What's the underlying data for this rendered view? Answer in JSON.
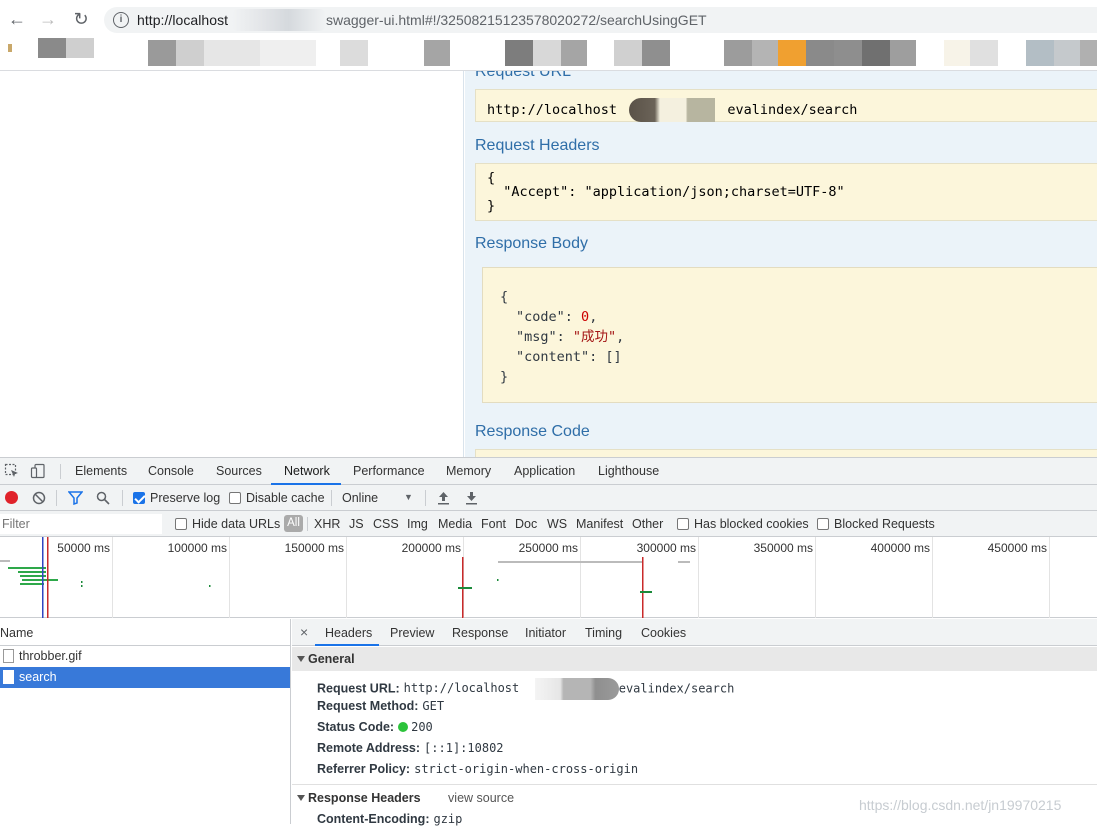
{
  "browser": {
    "url_start": "http://localhost",
    "url_end": "swagger-ui.html#!/3250821512357802027​2/searchUsingGET"
  },
  "request": {
    "url_title": "Request URL",
    "url_start": "http://localhost",
    "url_end": "evalindex/search",
    "headers_title": "Request Headers",
    "headers_lines": [
      "{",
      "  \"Accept\": \"application/json;charset=UTF-8\"",
      "}"
    ],
    "body_title": "Response Body",
    "body": {
      "open": "{",
      "code_key": "\"code\"",
      "code_val": "0",
      "msg_key": "\"msg\"",
      "msg_val": "\"成功\"",
      "content_key": "\"content\"",
      "content_val": "[]",
      "close": "}"
    },
    "code_title": "Response Code"
  },
  "devtools": {
    "tabs": [
      "Elements",
      "Console",
      "Sources",
      "Network",
      "Performance",
      "Memory",
      "Application",
      "Lighthouse"
    ],
    "active_tab": "Network",
    "toolbar": {
      "preserve_log": "Preserve log",
      "disable_cache": "Disable cache",
      "throttle": "Online"
    },
    "filter": {
      "placeholder": "Filter",
      "hide_data_urls": "Hide data URLs",
      "all": "All",
      "types": [
        "XHR",
        "JS",
        "CSS",
        "Img",
        "Media",
        "Font",
        "Doc",
        "WS",
        "Manifest",
        "Other"
      ],
      "has_blocked": "Has blocked cookies",
      "blocked_requests": "Blocked Requests"
    },
    "ticks": [
      "50000 ms",
      "100000 ms",
      "150000 ms",
      "200000 ms",
      "250000 ms",
      "300000 ms",
      "350000 ms",
      "400000 ms",
      "450000 ms"
    ],
    "name_header": "Name",
    "requests": [
      "throbber.gif",
      "search"
    ],
    "detail_tabs": [
      "Headers",
      "Preview",
      "Response",
      "Initiator",
      "Timing",
      "Cookies"
    ],
    "general_title": "General",
    "general": {
      "request_url_label": "Request URL:",
      "request_url_start": "http://localhost",
      "request_url_end": "evalindex/search",
      "method_label": "Request Method:",
      "method": "GET",
      "status_label": "Status Code:",
      "status": "200",
      "remote_label": "Remote Address:",
      "remote": "[::1]:10802",
      "referrer_label": "Referrer Policy:",
      "referrer": "strict-origin-when-cross-origin"
    },
    "response_headers_title": "Response Headers",
    "view_source": "view source",
    "content_encoding_label": "Content-Encoding:",
    "content_encoding": "gzip"
  },
  "watermark": "https://blog.csdn.net/jn19970215",
  "colors": {
    "accent": "#1a73e8",
    "swagger_title": "#2f6ea8",
    "code_bg": "#fcf6db",
    "selected_row": "#3879d9"
  }
}
